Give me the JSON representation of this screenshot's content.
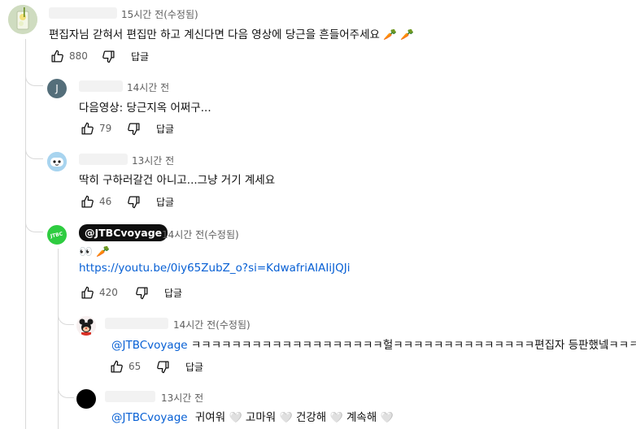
{
  "comments": [
    {
      "time": "15시간 전(수정됨)",
      "text": "편집자님 갇혀서 편집만 하고 계신다면 다음 영상에 당근을 흔들어주세요 🥕 🥕",
      "likes": "880",
      "reply_label": "답글",
      "avatar_icon": "lemonade-photo-avatar"
    },
    {
      "time": "14시간 전",
      "text": "다음영상: 당근지옥 어쩌구...",
      "likes": "79",
      "reply_label": "답글",
      "avatar_letter": "J",
      "avatar_color": "#546e7a"
    },
    {
      "time": "13시간 전",
      "text": "딱히 구하러갈건 아니고...그냥 거기 계세요",
      "likes": "46",
      "reply_label": "답글",
      "avatar_icon": "cartoon-face-avatar"
    },
    {
      "channel": "@JTBCvoyage",
      "time": "14시간 전(수정됨)",
      "text": "👀 🥕",
      "link": "https://youtu.be/0iy65ZubZ_o?si=KdwafriAIAIiJQJi",
      "likes": "420",
      "reply_label": "답글",
      "avatar_label": "JTBC",
      "avatar_color": "#2ecc40"
    },
    {
      "time": "14시간 전(수정됨)",
      "mention": "@JTBCvoyage",
      "text": "ㅋㅋㅋㅋㅋㅋㅋㅋㅋㅋㅋㅋㅋㅋㅋㅋㅋㅋㅋ헐ㅋㅋㅋㅋㅋㅋㅋㅋㅋㅋㅋㅋㅋㅋ편집자 등판했넼ㅋㅋㅋ",
      "likes": "65",
      "reply_label": "답글",
      "avatar_icon": "mickey-avatar"
    },
    {
      "time": "13시간 전",
      "mention": "@JTBCvoyage",
      "segments": [
        "귀여워",
        "고마워",
        "건강해",
        "계속해"
      ],
      "heart": "🤍",
      "avatar_color": "#000000"
    }
  ]
}
